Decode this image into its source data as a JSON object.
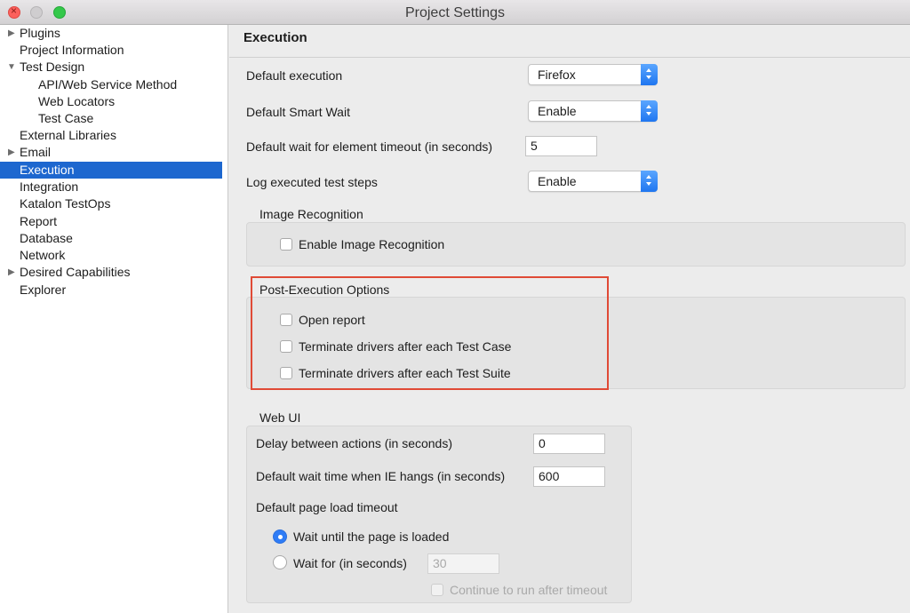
{
  "window": {
    "title": "Project Settings"
  },
  "sidebar": {
    "items": [
      {
        "label": "Plugins",
        "expandable": true
      },
      {
        "label": "Project Information"
      },
      {
        "label": "Test Design",
        "expanded": true
      },
      {
        "label": "API/Web Service Method"
      },
      {
        "label": "Web Locators"
      },
      {
        "label": "Test Case"
      },
      {
        "label": "External Libraries"
      },
      {
        "label": "Email",
        "expandable": true
      },
      {
        "label": "Execution",
        "selected": true
      },
      {
        "label": "Integration"
      },
      {
        "label": "Katalon TestOps"
      },
      {
        "label": "Report"
      },
      {
        "label": "Database"
      },
      {
        "label": "Network"
      },
      {
        "label": "Desired Capabilities",
        "expandable": true
      },
      {
        "label": "Explorer"
      }
    ]
  },
  "main": {
    "title": "Execution",
    "default_execution": {
      "label": "Default execution",
      "value": "Firefox"
    },
    "default_smart_wait": {
      "label": "Default Smart Wait",
      "value": "Enable"
    },
    "default_wait_timeout": {
      "label": "Default wait for element timeout (in seconds)",
      "value": "5"
    },
    "log_steps": {
      "label": "Log executed test steps",
      "value": "Enable"
    },
    "image_recognition": {
      "title": "Image Recognition",
      "enable_label": "Enable Image Recognition",
      "enabled": false
    },
    "post_execution": {
      "title": "Post-Execution Options",
      "open_report": "Open report",
      "terminate_test_case": "Terminate drivers after each Test Case",
      "terminate_test_suite": "Terminate drivers after each Test Suite"
    },
    "web_ui": {
      "title": "Web UI",
      "delay_label": "Delay between actions (in seconds)",
      "delay_value": "0",
      "ie_hang_label": "Default wait time when IE hangs (in seconds)",
      "ie_hang_value": "600",
      "page_load_label": "Default page load timeout",
      "wait_loaded_label": "Wait until the page is loaded",
      "wait_for_label": "Wait for (in seconds)",
      "wait_for_value": "30",
      "continue_label": "Continue to run after timeout",
      "selected_option": "wait_loaded"
    }
  },
  "colors": {
    "selection": "#1d67cf",
    "highlight": "#e04a36",
    "accent": "#2e7cf6"
  }
}
